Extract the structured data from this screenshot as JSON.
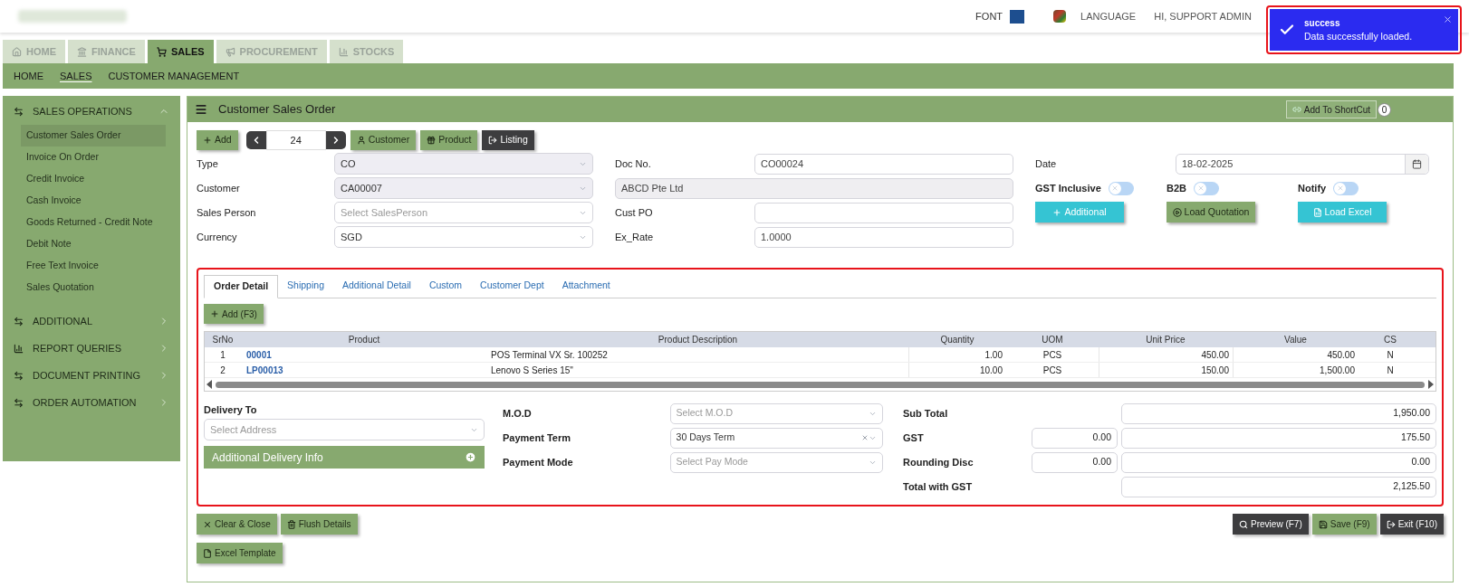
{
  "header": {
    "font_label": "FONT",
    "language_label": "LANGUAGE",
    "user": "HI, SUPPORT ADMIN"
  },
  "toast": {
    "title": "success",
    "message": "Data successfully loaded."
  },
  "modules": [
    {
      "label": "HOME",
      "selected": false
    },
    {
      "label": "FINANCE",
      "selected": false
    },
    {
      "label": "SALES",
      "selected": true
    },
    {
      "label": "PROCUREMENT",
      "selected": false
    },
    {
      "label": "STOCKS",
      "selected": false
    }
  ],
  "subnav": [
    {
      "label": "HOME",
      "selected": false
    },
    {
      "label": "SALES",
      "selected": true
    },
    {
      "label": "CUSTOMER MANAGEMENT",
      "selected": false
    }
  ],
  "sidebar": [
    {
      "label": "SALES OPERATIONS",
      "expanded": true,
      "items": [
        {
          "label": "Customer Sales Order",
          "selected": true
        },
        {
          "label": "Invoice On Order",
          "selected": false
        },
        {
          "label": "Credit Invoice",
          "selected": false
        },
        {
          "label": "Cash Invoice",
          "selected": false
        },
        {
          "label": "Goods Returned - Credit Note",
          "selected": false
        },
        {
          "label": "Debit Note",
          "selected": false
        },
        {
          "label": "Free Text Invoice",
          "selected": false
        },
        {
          "label": "Sales Quotation",
          "selected": false
        }
      ]
    },
    {
      "label": "ADDITIONAL",
      "expanded": false
    },
    {
      "label": "REPORT QUERIES",
      "expanded": false
    },
    {
      "label": "DOCUMENT PRINTING",
      "expanded": false
    },
    {
      "label": "ORDER AUTOMATION",
      "expanded": false
    }
  ],
  "page": {
    "title": "Customer Sales Order",
    "shortcut_button": "Add To ShortCut",
    "shortcut_count": "0"
  },
  "toolbar": {
    "add": "Add",
    "pager_value": "24",
    "buttons": [
      {
        "label": "Customer",
        "kind": "green"
      },
      {
        "label": "Product",
        "kind": "green"
      },
      {
        "label": "Listing",
        "kind": "dark"
      }
    ]
  },
  "form": {
    "left": [
      {
        "label": "Type",
        "value": "CO",
        "disabled": true
      },
      {
        "label": "Customer",
        "value": "CA00007",
        "disabled": true
      },
      {
        "label": "Sales Person",
        "placeholder": "Select SalesPerson",
        "disabled": false
      },
      {
        "label": "Currency",
        "value": "SGD",
        "disabled": false
      }
    ],
    "middle": [
      {
        "label": "Doc No.",
        "value": "CO00024",
        "disabled": false
      },
      {
        "value": "ABCD Pte Ltd",
        "disabled": true
      },
      {
        "label": "Cust PO",
        "disabled": false
      },
      {
        "label": "Ex_Rate",
        "value": "1.0000",
        "disabled": false
      }
    ],
    "date": {
      "label": "Date",
      "value": "18-02-2025"
    },
    "toggles": [
      {
        "label": "GST Inclusive",
        "on": false
      },
      {
        "label": "B2B",
        "on": false
      },
      {
        "label": "Notify",
        "on": false
      }
    ],
    "actions": [
      {
        "label": "Additional",
        "kind": "cyan"
      },
      {
        "label": "Load Quotation",
        "kind": "green"
      },
      {
        "label": "Load Excel",
        "kind": "cyan"
      }
    ]
  },
  "tabs": [
    {
      "label": "Order Detail",
      "selected": true
    },
    {
      "label": "Shipping",
      "selected": false
    },
    {
      "label": "Additional Detail",
      "selected": false
    },
    {
      "label": "Custom",
      "selected": false
    },
    {
      "label": "Customer Dept",
      "selected": false
    },
    {
      "label": "Attachment",
      "selected": false
    }
  ],
  "add_row_button": "Add (F3)",
  "table": {
    "columns": [
      "SrNo",
      "Product",
      "Product Description",
      "Quantity",
      "UOM",
      "Unit Price",
      "Value",
      "CS"
    ],
    "rows": [
      [
        "1",
        "00001",
        "POS Terminal VX Sr. 100252",
        "1.00",
        "PCS",
        "450.00",
        "450.00",
        "N"
      ],
      [
        "2",
        "LP00013",
        "Lenovo S Series 15\"",
        "10.00",
        "PCS",
        "150.00",
        "1,500.00",
        "N"
      ]
    ]
  },
  "delivery": {
    "label": "Delivery To",
    "placeholder": "Select Address",
    "info_bar": "Additional Delivery Info"
  },
  "payment": [
    {
      "label": "M.O.D",
      "placeholder": "Select M.O.D",
      "clearable": false
    },
    {
      "label": "Payment Term",
      "value": "30 Days Term",
      "clearable": true
    },
    {
      "label": "Payment Mode",
      "placeholder": "Select Pay Mode",
      "clearable": false
    }
  ],
  "totals": [
    {
      "label": "Sub Total",
      "value": "1,950.00"
    },
    {
      "label": "GST",
      "rate": "0.00",
      "value": "175.50"
    },
    {
      "label": "Rounding Disc",
      "rate": "0.00",
      "value": "0.00"
    },
    {
      "label": "Total with GST",
      "value": "2,125.50"
    }
  ],
  "footer_left": [
    "Clear & Close",
    "Flush Details",
    "Excel Template"
  ],
  "footer_right": [
    {
      "label": "Preview (F7)",
      "kind": "dark"
    },
    {
      "label": "Save (F9)",
      "kind": "green"
    },
    {
      "label": "Exit (F10)",
      "kind": "dark"
    }
  ]
}
